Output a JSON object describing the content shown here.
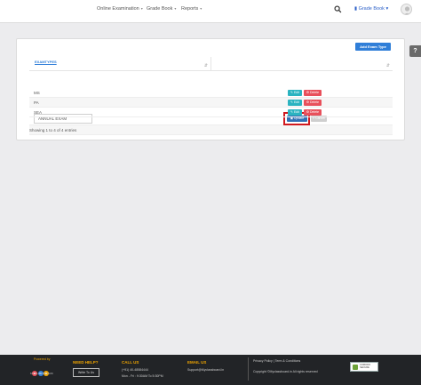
{
  "nav": {
    "items": [
      {
        "label": "Online Examination"
      },
      {
        "label": "Grade Book"
      },
      {
        "label": "Reports"
      }
    ],
    "grade_book_link": "Grade Book",
    "help_label": "?"
  },
  "toolbar": {
    "add_button": "Add Exam Type"
  },
  "table": {
    "column_header": "EXAMTYPES",
    "edit_row": {
      "value": "ANNUAL EXAM",
      "update_label": "Update",
      "cancel_label": "Cancel"
    },
    "rows": [
      {
        "name": "MS",
        "edit": "Edit",
        "delete": "Delete"
      },
      {
        "name": "PA",
        "edit": "Edit",
        "delete": "Delete"
      },
      {
        "name": "SEA",
        "edit": "Edit",
        "delete": "Delete"
      }
    ],
    "showing": "Showing 1 to 4 of 4 entries"
  },
  "footer": {
    "powered_by": "Powered by",
    "brand": "MY CLASSBOARD",
    "need_help": "NEED HELP?",
    "write_to_us": "Write To Us",
    "call_us": "CALL US",
    "phone": "(+91) 40-48584444",
    "hours": "Mon - Fri : 9:30AM To 5:30PM",
    "email_us": "EMAIL US",
    "email": "Support@Myclassboard.in",
    "privacy": "Privacy Policy",
    "separator": "|",
    "terms": "Term & Conditions",
    "copyright": "Copyright ©Myclassboard.in All rights reserved",
    "badge_line1": "COMODO",
    "badge_line2": "SECURE"
  },
  "colors": {
    "primary": "#2f7ed8",
    "edit": "#2bb3c0",
    "delete": "#e8505b",
    "highlight": "#d0191f",
    "footer_accent": "#f0a500"
  }
}
